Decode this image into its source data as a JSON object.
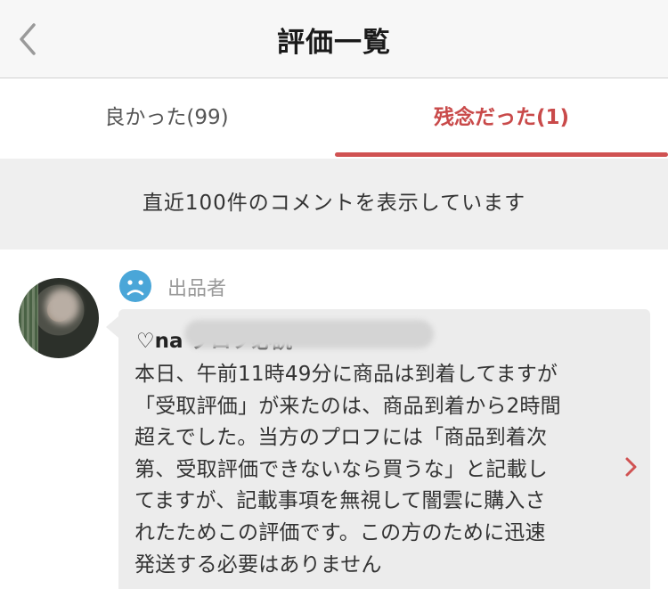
{
  "header": {
    "title": "評価一覧"
  },
  "tabs": [
    {
      "label": "良かった(99)",
      "active": false
    },
    {
      "label": "残念だった(1)",
      "active": true
    }
  ],
  "notice": "直近100件のコメントを表示しています",
  "review": {
    "role": "出品者",
    "name": "♡na                      プロフ必読",
    "comment_lines": [
      "本日、午前11時49分に商品は到着してますが",
      "「受取評価」が来たのは、商品到着から2時間",
      "超えでした。当方のプロフには「商品到着次",
      "第、受取評価できないなら買うな」と記載し",
      "てますが、記載事項を無視して闇雲に購入さ",
      "れたためこの評価です。この方のために迅速",
      "発送する必要はありません"
    ]
  },
  "colors": {
    "accent": "#d05252",
    "notice_bg": "#efefef",
    "bubble_bg": "#ececec",
    "icon_blue": "#4aa6d8"
  },
  "icons": {
    "back": "chevron-left-icon",
    "sentiment": "sad-face-icon",
    "more": "chevron-right-icon"
  }
}
